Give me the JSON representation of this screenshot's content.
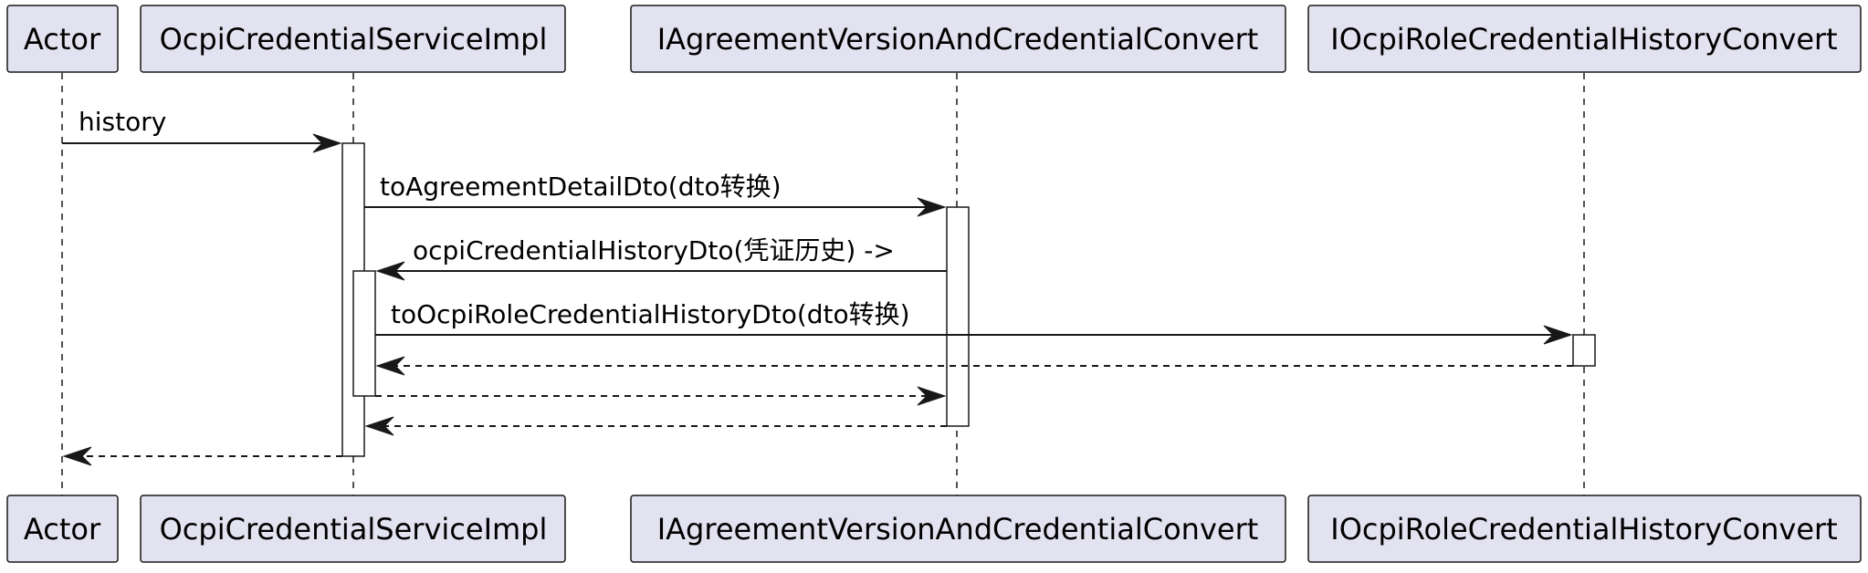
{
  "participants": [
    {
      "id": "actor",
      "label": "Actor"
    },
    {
      "id": "service",
      "label": "OcpiCredentialServiceImpl"
    },
    {
      "id": "agreementConvert",
      "label": "IAgreementVersionAndCredentialConvert"
    },
    {
      "id": "roleHistoryConvert",
      "label": "IOcpiRoleCredentialHistoryConvert"
    }
  ],
  "messages": [
    {
      "from": "actor",
      "to": "service",
      "label": "history",
      "style": "solid"
    },
    {
      "from": "service",
      "to": "agreementConvert",
      "label": "toAgreementDetailDto(dto转换)",
      "style": "solid"
    },
    {
      "from": "agreementConvert",
      "to": "service",
      "label": "ocpiCredentialHistoryDto(凭证历史) ->",
      "style": "solid"
    },
    {
      "from": "service",
      "to": "roleHistoryConvert",
      "label": "toOcpiRoleCredentialHistoryDto(dto转换)",
      "style": "solid"
    },
    {
      "from": "roleHistoryConvert",
      "to": "service",
      "label": "",
      "style": "dashed"
    },
    {
      "from": "service",
      "to": "agreementConvert",
      "label": "",
      "style": "dashed"
    },
    {
      "from": "agreementConvert",
      "to": "service",
      "label": "",
      "style": "dashed"
    },
    {
      "from": "service",
      "to": "actor",
      "label": "",
      "style": "dashed"
    }
  ]
}
